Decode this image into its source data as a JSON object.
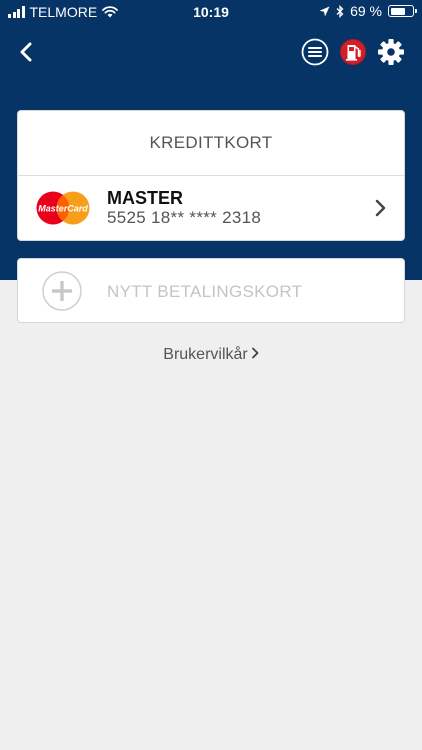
{
  "status_bar": {
    "carrier": "TELMORE",
    "time": "10:19",
    "battery_percent": "69 %",
    "battery_level": 0.69
  },
  "nav": {
    "icons": [
      "back-icon",
      "menu-icon",
      "fuel-pump-icon",
      "gear-icon"
    ]
  },
  "credit_card_section": {
    "title": "KREDITTKORT",
    "card": {
      "brand_logo_text": "MasterCard",
      "name": "MASTER",
      "number": "5525 18** **** 2318"
    }
  },
  "new_card": {
    "label": "NYTT BETALINGSKORT"
  },
  "terms_link": {
    "label": "Brukervilkår"
  },
  "colors": {
    "header_bg": "#073466",
    "page_bg": "#efefef",
    "fuel_icon": "#d01f2b",
    "mc_red": "#eb001b",
    "mc_orange": "#f79e1b"
  }
}
